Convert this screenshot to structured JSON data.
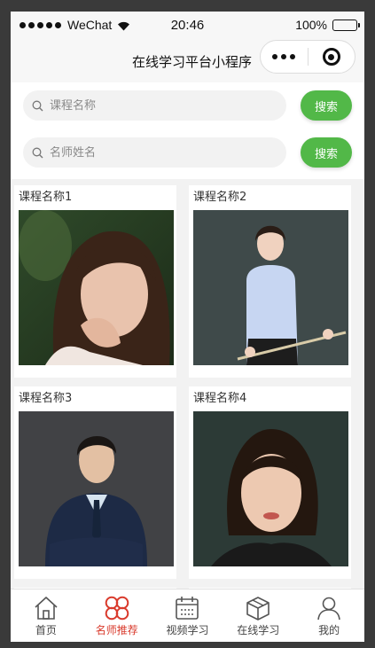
{
  "status_bar": {
    "carrier": "WeChat",
    "time": "20:46",
    "battery": "100%",
    "battery_level": 1.0
  },
  "navbar": {
    "title": "在线学习平台小程序"
  },
  "search": {
    "course_placeholder": "课程名称",
    "teacher_placeholder": "名师姓名",
    "button_label": "搜索"
  },
  "cards": [
    {
      "name": "课程名称1"
    },
    {
      "name": "课程名称2"
    },
    {
      "name": "课程名称3"
    },
    {
      "name": "课程名称4"
    }
  ],
  "tabs": [
    {
      "label": "首页",
      "icon": "home-icon",
      "active": false
    },
    {
      "label": "名师推荐",
      "icon": "clover-icon",
      "active": true
    },
    {
      "label": "视频学习",
      "icon": "calendar-icon",
      "active": false
    },
    {
      "label": "在线学习",
      "icon": "box-icon",
      "active": false
    },
    {
      "label": "我的",
      "icon": "user-icon",
      "active": false
    }
  ],
  "colors": {
    "accent_green": "#52b848",
    "active_tab_red": "#d93a2c"
  }
}
